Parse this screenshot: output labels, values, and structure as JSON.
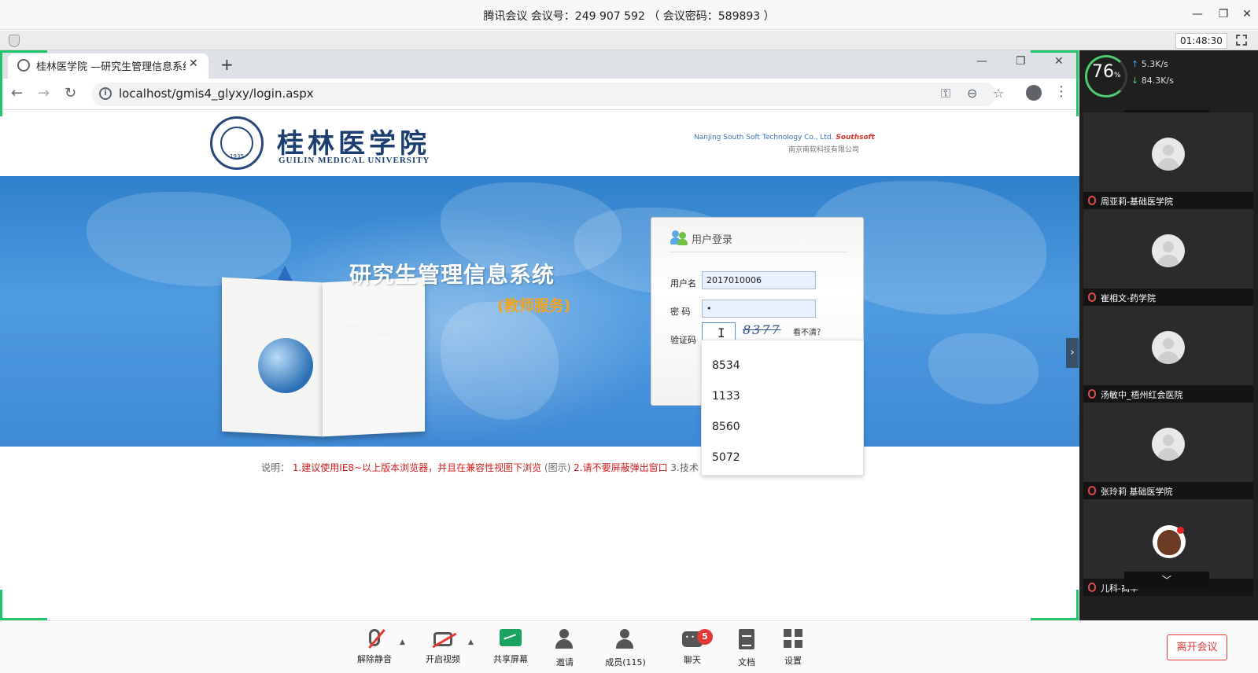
{
  "meeting": {
    "title": "腾讯会议 会议号：249 907 592 （ 会议密码：589893 ）",
    "timer": "01:48:30",
    "window_controls": {
      "minimize": "—",
      "restore": "❐",
      "close": "✕"
    }
  },
  "browser": {
    "tab_title": "桂林医学院 —研究生管理信息系统",
    "tab_close": "✕",
    "new_tab": "+",
    "url": "localhost/gmis4_glyxy/login.aspx",
    "controls": {
      "minimize": "—",
      "restore": "❐",
      "close": "✕"
    },
    "icons": [
      "back-icon",
      "forward-icon",
      "reload-icon",
      "info-icon",
      "key-icon",
      "zoom-out-icon",
      "star-icon",
      "profile-icon",
      "menu-icon"
    ]
  },
  "page": {
    "logo_cn": "桂林医学院",
    "logo_en": "GUILIN MEDICAL UNIVERSITY",
    "logo_seal_year": "1935",
    "vendor_en": "Nanjing South Soft Technology Co., Ltd.",
    "vendor_brand": "Southsoft",
    "vendor_cn": "南京南软科技有限公司",
    "banner_title": "研究生管理信息系统",
    "banner_subtitle": "(教师服务)",
    "login": {
      "title": "用户登录",
      "username_label": "用户名",
      "username_value": "2017010006",
      "password_label": "密  码",
      "password_value": "•",
      "captcha_label": "验证码",
      "captcha_image_text": "8377",
      "refresh_link": "看不清？"
    },
    "autocomplete": [
      "8534",
      "1133",
      "8560",
      "5072"
    ],
    "notice": {
      "prefix": "说明：",
      "item1": "1.建议使用IE8~以上版本浏览器，并且在兼容性视图下浏览",
      "item1_hint": "(图示)",
      "item2": "2.请不要屏蔽弹出窗口",
      "item3": "3.技术"
    }
  },
  "side_panel": {
    "network": {
      "quality": "76",
      "unit": "%",
      "up": "5.3K/s",
      "down": "84.3K/s"
    },
    "scroll_up": "︿",
    "scroll_down": "﹀",
    "toggle": "›",
    "participants": [
      {
        "name": "周亚莉-基础医学院"
      },
      {
        "name": "崔相文-药学院"
      },
      {
        "name": "汤敏中_梧州红会医院"
      },
      {
        "name": "张玲莉 基础医学院"
      },
      {
        "name": "儿科-高华"
      }
    ]
  },
  "toolbar": {
    "mute": "解除静音",
    "video": "开启视频",
    "share": "共享屏幕",
    "invite": "邀请",
    "members": "成员(115)",
    "chat": "聊天",
    "chat_badge": "5",
    "docs": "文档",
    "settings": "设置",
    "caret": "▲",
    "leave": "离开会议"
  },
  "colors": {
    "accent_green": "#21c46a",
    "leave_red": "#e23a3a",
    "banner_blue": "#3f8ad6"
  }
}
